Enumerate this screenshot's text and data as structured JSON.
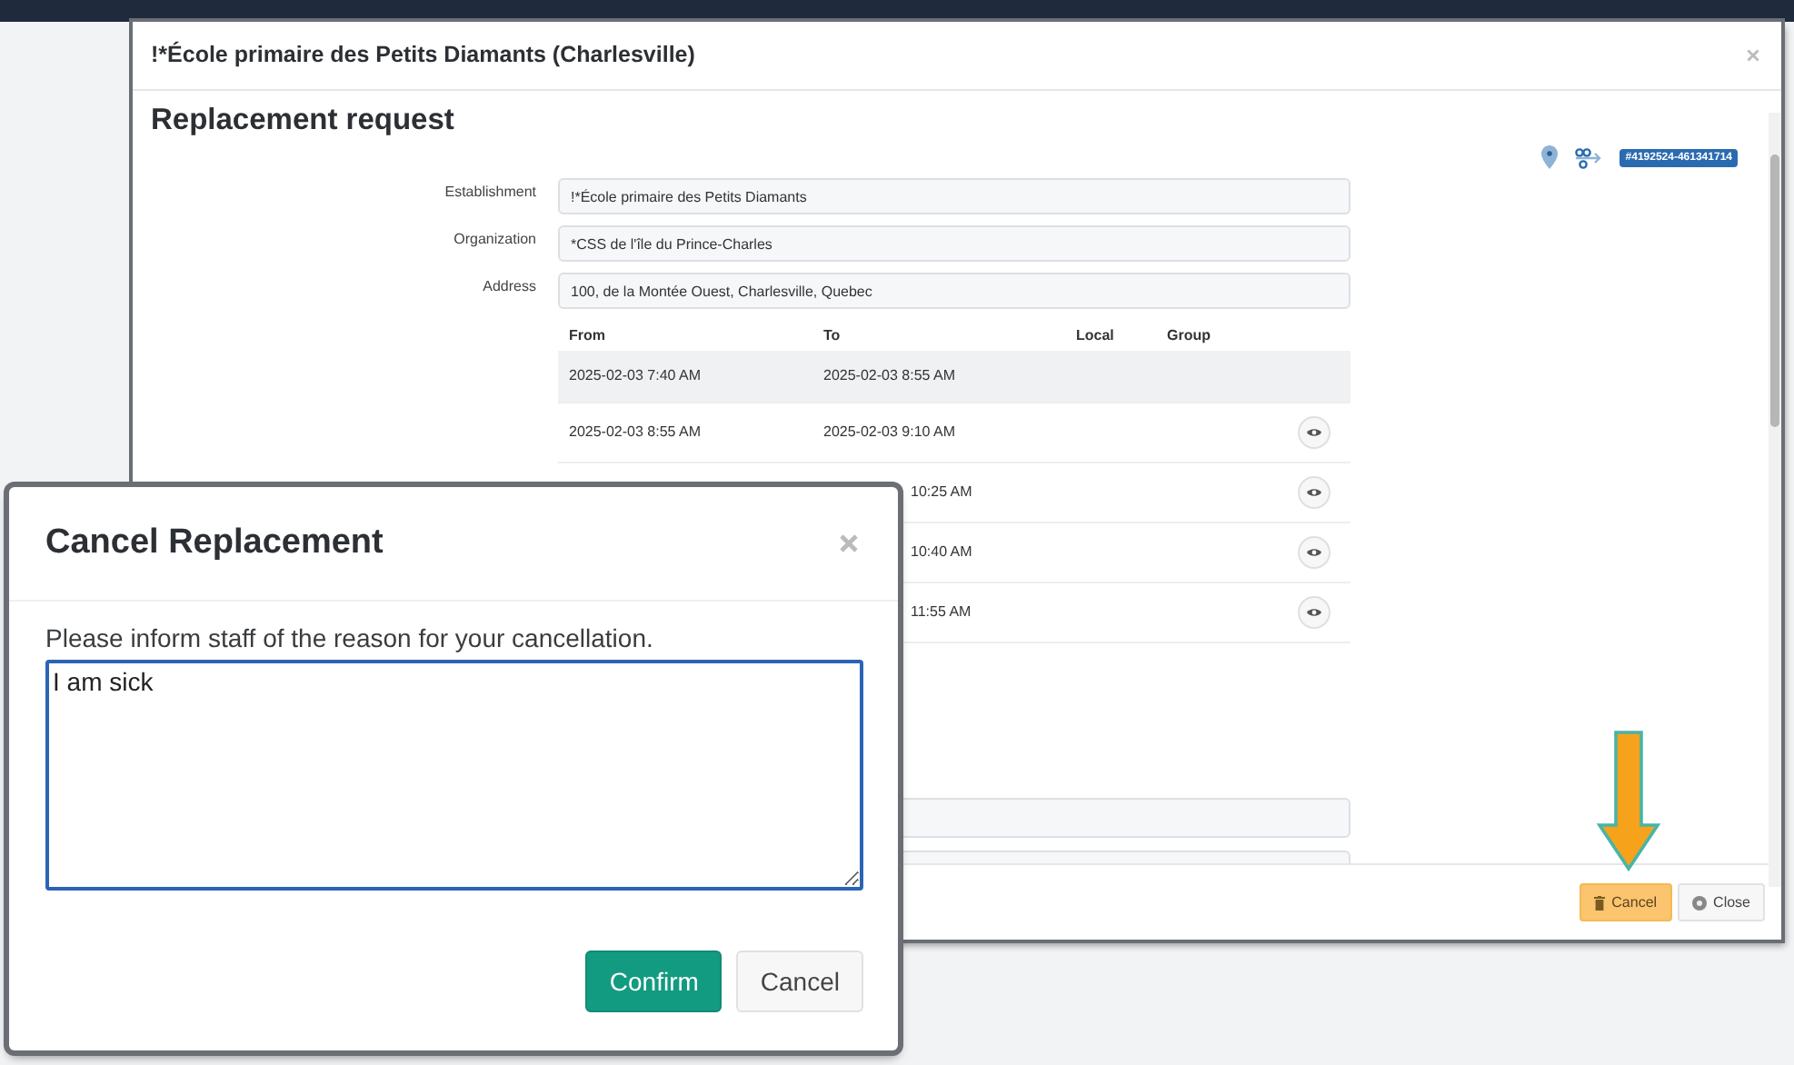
{
  "window": {
    "title": "!*École primaire des Petits Diamants (Charlesville)"
  },
  "request": {
    "heading": "Replacement request",
    "reference": "#4192524-461341714",
    "fields": [
      {
        "label": "Establishment",
        "value": "!*École primaire des Petits Diamants"
      },
      {
        "label": "Organization",
        "value": "*CSS de l'île du Prince-Charles"
      },
      {
        "label": "Address",
        "value": "100, de la Montée Ouest, Charlesville, Quebec"
      }
    ],
    "schedule": {
      "columns": [
        "From",
        "To",
        "Local",
        "Group"
      ],
      "rows": [
        {
          "from": "2025-02-03 7:40 AM",
          "to": "2025-02-03 8:55 AM",
          "highlighted": true,
          "viewable": false
        },
        {
          "from": "2025-02-03 8:55 AM",
          "to": "2025-02-03 9:10 AM",
          "highlighted": false,
          "viewable": true
        },
        {
          "to": "10:25 AM",
          "highlighted": false,
          "viewable": true
        },
        {
          "to": "10:40 AM",
          "highlighted": false,
          "viewable": true
        },
        {
          "to": "11:55 AM",
          "highlighted": false,
          "viewable": true
        }
      ]
    }
  },
  "footer_buttons": [
    {
      "label": "Cancel",
      "kind": "warning"
    },
    {
      "label": "Close",
      "kind": "default"
    }
  ],
  "dialog": {
    "title": "Cancel Replacement",
    "prompt": "Please inform staff of the reason for your cancellation.",
    "reason": {
      "value": "I am sick",
      "focused": true
    },
    "buttons": [
      {
        "label": "Confirm",
        "kind": "primary"
      },
      {
        "label": "Cancel",
        "kind": "default"
      }
    ]
  }
}
